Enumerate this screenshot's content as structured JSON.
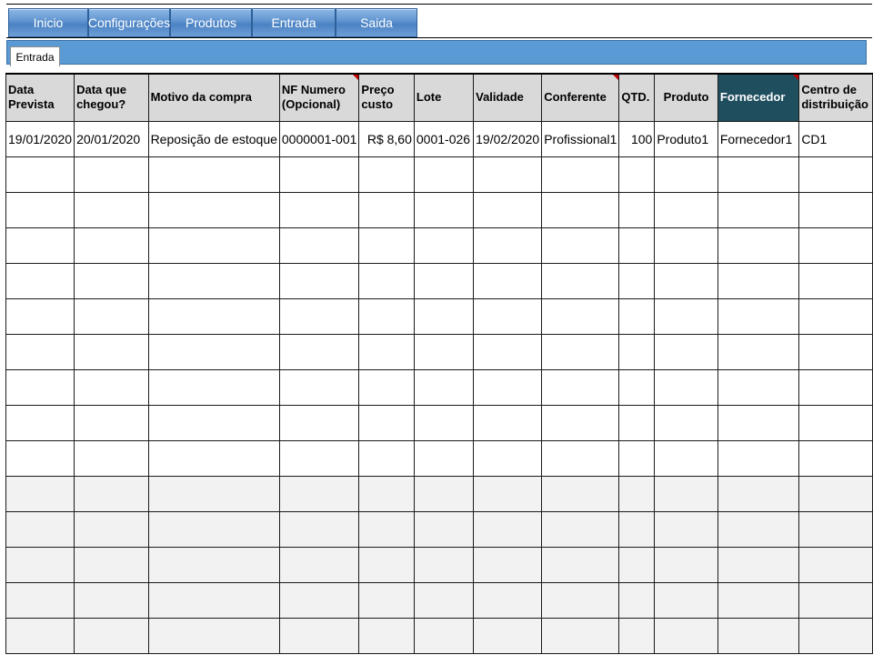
{
  "nav": {
    "items": [
      {
        "label": "Inicio"
      },
      {
        "label": "Configurações"
      },
      {
        "label": "Produtos"
      },
      {
        "label": "Entrada"
      },
      {
        "label": "Saida"
      }
    ]
  },
  "sheet_tab": {
    "label": "Entrada"
  },
  "table": {
    "headers": [
      "Data Prevista",
      "Data que chegou?",
      "Motivo da compra",
      "NF Numero (Opcional)",
      "Preço custo",
      "Lote",
      "Validade",
      "Conferente",
      "QTD.",
      "Produto",
      "Fornecedor",
      "Centro de distribuição"
    ],
    "rows": [
      [
        "19/01/2020",
        "20/01/2020",
        "Reposição de estoque",
        "0000001-001",
        "R$ 8,60",
        "0001-026",
        "19/02/2020",
        "Profissional1",
        "100",
        "Produto1",
        "Fornecedor1",
        "CD1"
      ]
    ]
  }
}
